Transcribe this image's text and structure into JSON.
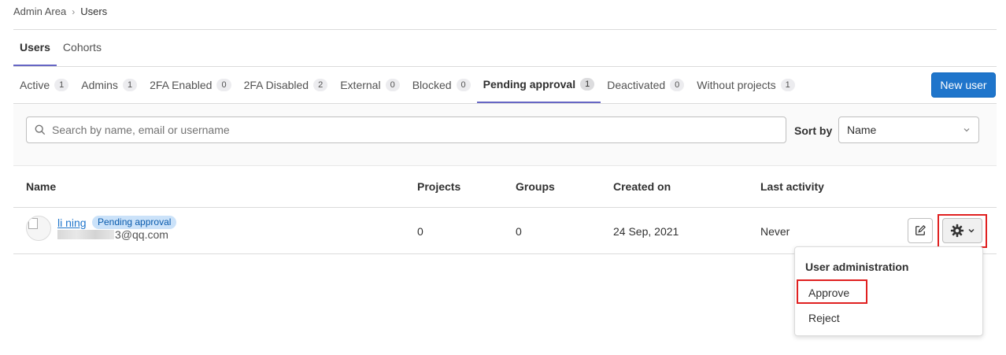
{
  "breadcrumb": {
    "parent": "Admin Area",
    "current": "Users"
  },
  "top_tabs": [
    {
      "label": "Users"
    },
    {
      "label": "Cohorts"
    }
  ],
  "filter_tabs": [
    {
      "label": "Active",
      "count": "1"
    },
    {
      "label": "Admins",
      "count": "1"
    },
    {
      "label": "2FA Enabled",
      "count": "0"
    },
    {
      "label": "2FA Disabled",
      "count": "2"
    },
    {
      "label": "External",
      "count": "0"
    },
    {
      "label": "Blocked",
      "count": "0"
    },
    {
      "label": "Pending approval",
      "count": "1"
    },
    {
      "label": "Deactivated",
      "count": "0"
    },
    {
      "label": "Without projects",
      "count": "1"
    }
  ],
  "new_user_label": "New user",
  "search": {
    "placeholder": "Search by name, email or username"
  },
  "sort": {
    "label": "Sort by",
    "value": "Name"
  },
  "table": {
    "headers": {
      "name": "Name",
      "projects": "Projects",
      "groups": "Groups",
      "created": "Created on",
      "activity": "Last activity"
    },
    "row": {
      "name": "li ning",
      "badge": "Pending approval",
      "email_suffix": "3@qq.com",
      "projects": "0",
      "groups": "0",
      "created": "24 Sep, 2021",
      "activity": "Never"
    }
  },
  "menu": {
    "heading": "User administration",
    "items": {
      "approve": "Approve",
      "reject": "Reject"
    }
  },
  "colors": {
    "accent": "#1f75cb",
    "tab_underline": "#6666c4",
    "highlight": "#e02020"
  }
}
